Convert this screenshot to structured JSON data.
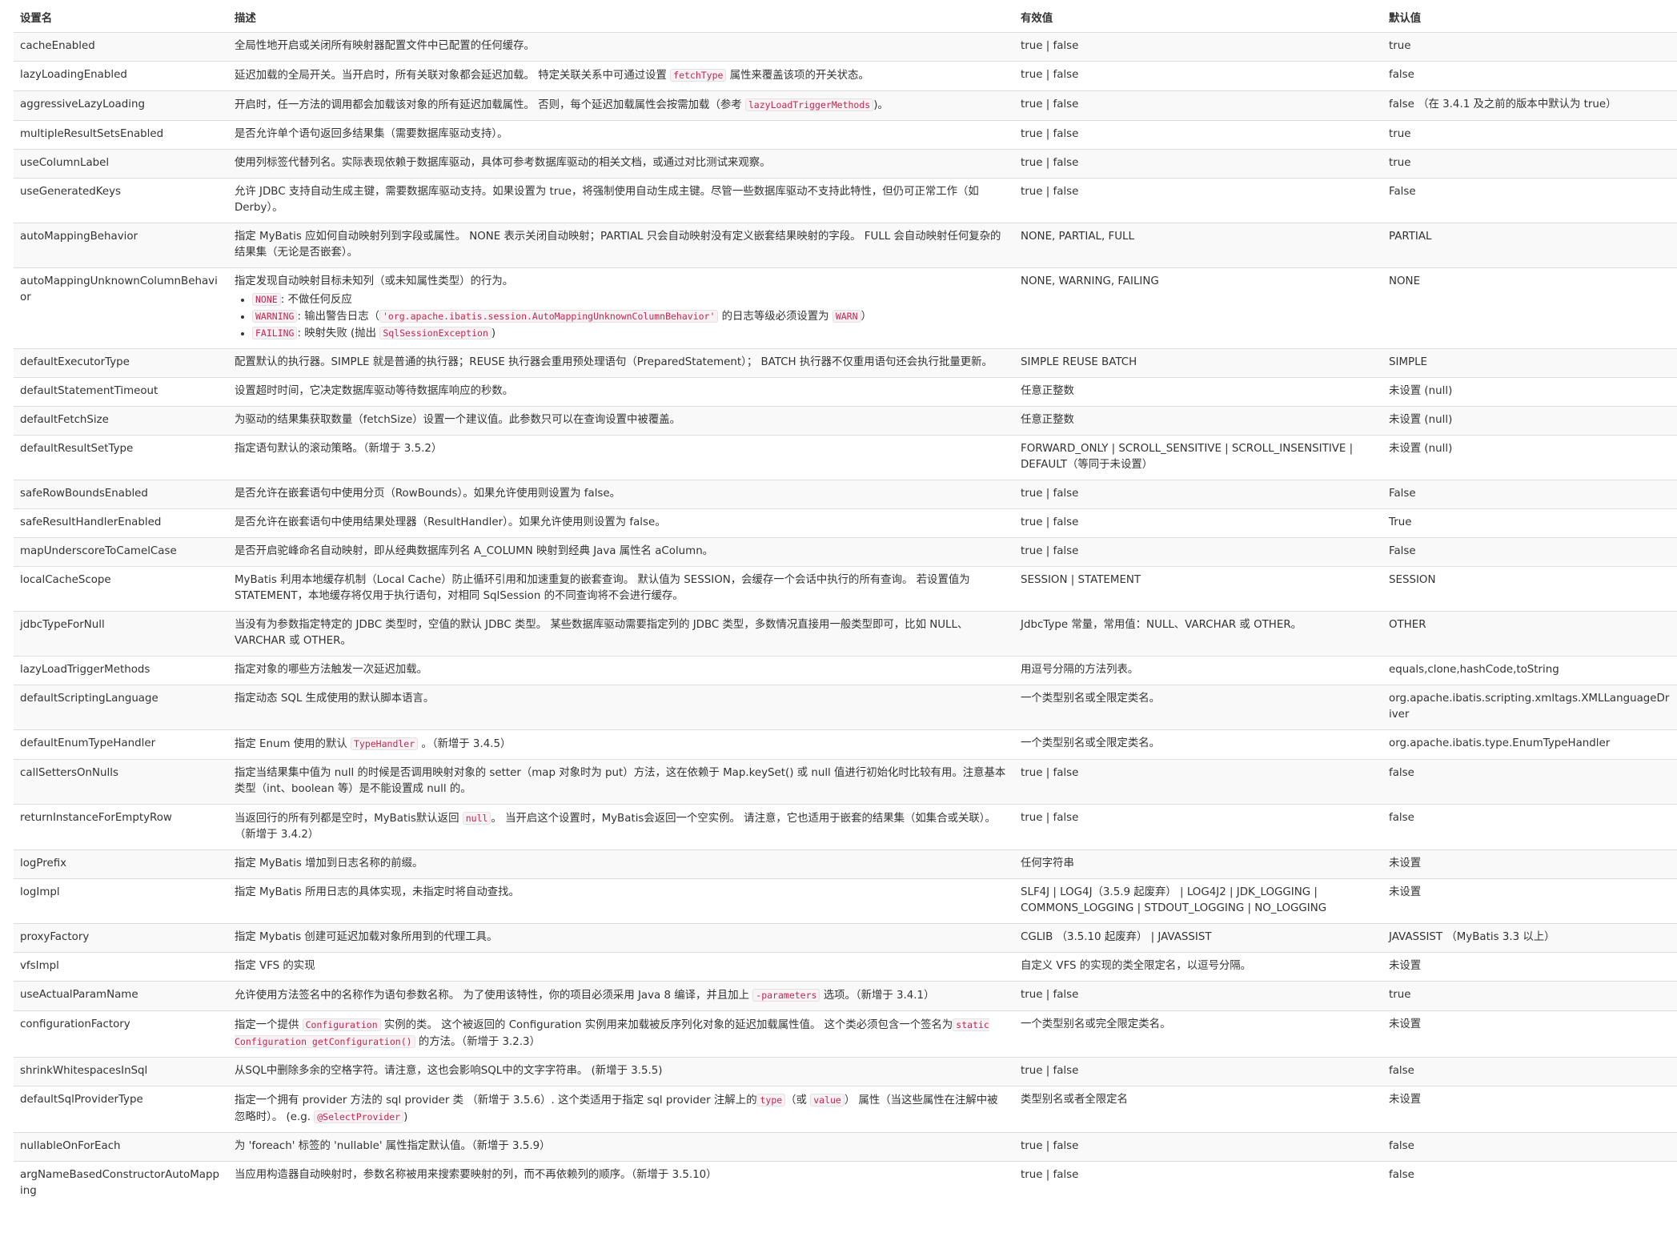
{
  "headers": [
    "设置名",
    "描述",
    "有效值",
    "默认值"
  ],
  "rows": [
    {
      "name": "cacheEnabled",
      "desc": [
        "全局性地开启或关闭所有映射器配置文件中已配置的任何缓存。"
      ],
      "values": "true | false",
      "default": "true"
    },
    {
      "name": "lazyLoadingEnabled",
      "desc": [
        "延迟加载的全局开关。当开启时，所有关联对象都会延迟加载。 特定关联关系中可通过设置 ",
        {
          "code": "fetchType"
        },
        " 属性来覆盖该项的开关状态。"
      ],
      "values": "true | false",
      "default": "false"
    },
    {
      "name": "aggressiveLazyLoading",
      "desc": [
        "开启时，任一方法的调用都会加载该对象的所有延迟加载属性。 否则，每个延迟加载属性会按需加载（参考 ",
        {
          "code": "lazyLoadTriggerMethods"
        },
        ")。"
      ],
      "values": "true | false",
      "default": "false （在 3.4.1 及之前的版本中默认为 true）"
    },
    {
      "name": "multipleResultSetsEnabled",
      "desc": [
        "是否允许单个语句返回多结果集（需要数据库驱动支持）。"
      ],
      "values": "true | false",
      "default": "true"
    },
    {
      "name": "useColumnLabel",
      "desc": [
        "使用列标签代替列名。实际表现依赖于数据库驱动，具体可参考数据库驱动的相关文档，或通过对比测试来观察。"
      ],
      "values": "true | false",
      "default": "true"
    },
    {
      "name": "useGeneratedKeys",
      "desc": [
        "允许 JDBC 支持自动生成主键，需要数据库驱动支持。如果设置为 true，将强制使用自动生成主键。尽管一些数据库驱动不支持此特性，但仍可正常工作（如 Derby）。"
      ],
      "values": "true | false",
      "default": "False"
    },
    {
      "name": "autoMappingBehavior",
      "desc": [
        "指定 MyBatis 应如何自动映射列到字段或属性。 NONE 表示关闭自动映射；PARTIAL 只会自动映射没有定义嵌套结果映射的字段。 FULL 会自动映射任何复杂的结果集（无论是否嵌套）。"
      ],
      "values": "NONE, PARTIAL, FULL",
      "default": "PARTIAL"
    },
    {
      "name": "autoMappingUnknownColumnBehavior",
      "desc": [
        "指定发现自动映射目标未知列（或未知属性类型）的行为。"
      ],
      "list": [
        [
          {
            "code": "NONE"
          },
          ": 不做任何反应"
        ],
        [
          {
            "code": "WARNING"
          },
          ": 输出警告日志（",
          {
            "code": "'org.apache.ibatis.session.AutoMappingUnknownColumnBehavior'"
          },
          " 的日志等级必须设置为 ",
          {
            "code": "WARN"
          },
          "）"
        ],
        [
          {
            "code": "FAILING"
          },
          ": 映射失败 (抛出 ",
          {
            "code": "SqlSessionException"
          },
          ")"
        ]
      ],
      "values": "NONE, WARNING, FAILING",
      "default": "NONE"
    },
    {
      "name": "defaultExecutorType",
      "desc": [
        "配置默认的执行器。SIMPLE 就是普通的执行器；REUSE 执行器会重用预处理语句（PreparedStatement）； BATCH 执行器不仅重用语句还会执行批量更新。"
      ],
      "values": "SIMPLE REUSE BATCH",
      "default": "SIMPLE"
    },
    {
      "name": "defaultStatementTimeout",
      "desc": [
        "设置超时时间，它决定数据库驱动等待数据库响应的秒数。"
      ],
      "values": "任意正整数",
      "default": "未设置 (null)"
    },
    {
      "name": "defaultFetchSize",
      "desc": [
        "为驱动的结果集获取数量（fetchSize）设置一个建议值。此参数只可以在查询设置中被覆盖。"
      ],
      "values": "任意正整数",
      "default": "未设置 (null)"
    },
    {
      "name": "defaultResultSetType",
      "desc": [
        "指定语句默认的滚动策略。（新增于 3.5.2）"
      ],
      "values": "FORWARD_ONLY | SCROLL_SENSITIVE | SCROLL_INSENSITIVE | DEFAULT（等同于未设置）",
      "default": "未设置 (null)"
    },
    {
      "name": "safeRowBoundsEnabled",
      "desc": [
        "是否允许在嵌套语句中使用分页（RowBounds）。如果允许使用则设置为 false。"
      ],
      "values": "true | false",
      "default": "False"
    },
    {
      "name": "safeResultHandlerEnabled",
      "desc": [
        "是否允许在嵌套语句中使用结果处理器（ResultHandler）。如果允许使用则设置为 false。"
      ],
      "values": "true | false",
      "default": "True"
    },
    {
      "name": "mapUnderscoreToCamelCase",
      "desc": [
        "是否开启驼峰命名自动映射，即从经典数据库列名 A_COLUMN 映射到经典 Java 属性名 aColumn。"
      ],
      "values": "true | false",
      "default": "False"
    },
    {
      "name": "localCacheScope",
      "desc": [
        "MyBatis 利用本地缓存机制（Local Cache）防止循环引用和加速重复的嵌套查询。 默认值为 SESSION，会缓存一个会话中执行的所有查询。 若设置值为 STATEMENT，本地缓存将仅用于执行语句，对相同 SqlSession 的不同查询将不会进行缓存。"
      ],
      "values": "SESSION | STATEMENT",
      "default": "SESSION"
    },
    {
      "name": "jdbcTypeForNull",
      "desc": [
        "当没有为参数指定特定的 JDBC 类型时，空值的默认 JDBC 类型。 某些数据库驱动需要指定列的 JDBC 类型，多数情况直接用一般类型即可，比如 NULL、VARCHAR 或 OTHER。"
      ],
      "values": "JdbcType 常量，常用值：NULL、VARCHAR 或 OTHER。",
      "default": "OTHER"
    },
    {
      "name": "lazyLoadTriggerMethods",
      "desc": [
        "指定对象的哪些方法触发一次延迟加载。"
      ],
      "values": "用逗号分隔的方法列表。",
      "default": "equals,clone,hashCode,toString"
    },
    {
      "name": "defaultScriptingLanguage",
      "desc": [
        "指定动态 SQL 生成使用的默认脚本语言。"
      ],
      "values": "一个类型别名或全限定类名。",
      "default": "org.apache.ibatis.scripting.xmltags.XMLLanguageDriver"
    },
    {
      "name": "defaultEnumTypeHandler",
      "desc": [
        "指定 Enum 使用的默认 ",
        {
          "code": "TypeHandler"
        },
        " 。（新增于 3.4.5）"
      ],
      "values": "一个类型别名或全限定类名。",
      "default": "org.apache.ibatis.type.EnumTypeHandler"
    },
    {
      "name": "callSettersOnNulls",
      "desc": [
        "指定当结果集中值为 null 的时候是否调用映射对象的 setter（map 对象时为 put）方法，这在依赖于 Map.keySet() 或 null 值进行初始化时比较有用。注意基本类型（int、boolean 等）是不能设置成 null 的。"
      ],
      "values": "true | false",
      "default": "false"
    },
    {
      "name": "returnInstanceForEmptyRow",
      "desc": [
        "当返回行的所有列都是空时，MyBatis默认返回 ",
        {
          "code": "null"
        },
        "。 当开启这个设置时，MyBatis会返回一个空实例。 请注意，它也适用于嵌套的结果集（如集合或关联）。（新增于 3.4.2）"
      ],
      "values": "true | false",
      "default": "false"
    },
    {
      "name": "logPrefix",
      "desc": [
        "指定 MyBatis 增加到日志名称的前缀。"
      ],
      "values": "任何字符串",
      "default": "未设置"
    },
    {
      "name": "logImpl",
      "desc": [
        "指定 MyBatis 所用日志的具体实现，未指定时将自动查找。"
      ],
      "values": "SLF4J | LOG4J（3.5.9 起废弃） | LOG4J2 | JDK_LOGGING | COMMONS_LOGGING | STDOUT_LOGGING | NO_LOGGING",
      "default": "未设置"
    },
    {
      "name": "proxyFactory",
      "desc": [
        "指定 Mybatis 创建可延迟加载对象所用到的代理工具。"
      ],
      "values": "CGLIB （3.5.10 起废弃） | JAVASSIST",
      "default": "JAVASSIST （MyBatis 3.3 以上）"
    },
    {
      "name": "vfsImpl",
      "desc": [
        "指定 VFS 的实现"
      ],
      "values": "自定义 VFS 的实现的类全限定名，以逗号分隔。",
      "default": "未设置"
    },
    {
      "name": "useActualParamName",
      "desc": [
        "允许使用方法签名中的名称作为语句参数名称。 为了使用该特性，你的项目必须采用 Java 8 编译，并且加上 ",
        {
          "code": "-parameters"
        },
        " 选项。（新增于 3.4.1）"
      ],
      "values": "true | false",
      "default": "true"
    },
    {
      "name": "configurationFactory",
      "desc": [
        "指定一个提供 ",
        {
          "code": "Configuration"
        },
        " 实例的类。 这个被返回的 Configuration 实例用来加载被反序列化对象的延迟加载属性值。 这个类必须包含一个签名为",
        {
          "code": "static Configuration getConfiguration()"
        },
        " 的方法。（新增于 3.2.3）"
      ],
      "values": "一个类型别名或完全限定类名。",
      "default": "未设置"
    },
    {
      "name": "shrinkWhitespacesInSql",
      "desc": [
        "从SQL中删除多余的空格字符。请注意，这也会影响SQL中的文字字符串。 (新增于 3.5.5)"
      ],
      "values": "true | false",
      "default": "false"
    },
    {
      "name": "defaultSqlProviderType",
      "desc": [
        "指定一个拥有 provider 方法的 sql provider 类 （新增于 3.5.6）. 这个类适用于指定 sql provider 注解上的",
        {
          "code": "type"
        },
        "（或 ",
        {
          "code": "value"
        },
        "） 属性（当这些属性在注解中被忽略时）。 (e.g. ",
        {
          "code": "@SelectProvider"
        },
        ")"
      ],
      "values": "类型别名或者全限定名",
      "default": "未设置"
    },
    {
      "name": "nullableOnForEach",
      "desc": [
        "为 'foreach' 标签的 'nullable' 属性指定默认值。（新增于 3.5.9）"
      ],
      "values": "true | false",
      "default": "false"
    },
    {
      "name": "argNameBasedConstructorAutoMapping",
      "desc": [
        "当应用构造器自动映射时，参数名称被用来搜索要映射的列，而不再依赖列的顺序。（新增于 3.5.10）"
      ],
      "values": "true | false",
      "default": "false"
    }
  ]
}
